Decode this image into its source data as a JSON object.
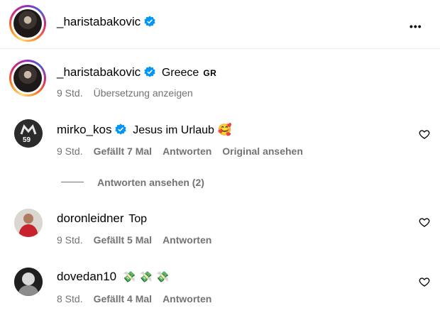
{
  "header": {
    "username": "_haristabakovic",
    "more_icon": "more-horizontal-icon",
    "more_glyph": "•••"
  },
  "caption": {
    "username": "_haristabakovic",
    "text": "Greece",
    "flag": "GR",
    "time": "9 Std.",
    "translate": "Übersetzung anzeigen"
  },
  "comments": [
    {
      "username": "mirko_kos",
      "verified": true,
      "text": "Jesus im Urlaub",
      "emoji": "🥰",
      "time": "9 Std.",
      "likes": "Gefällt 7 Mal",
      "reply": "Antworten",
      "original": "Original ansehen",
      "avatar_text": "59"
    },
    {
      "username": "doronleidner",
      "verified": false,
      "text": "Top",
      "time": "9 Std.",
      "likes": "Gefällt 5 Mal",
      "reply": "Antworten"
    },
    {
      "username": "dovedan10",
      "verified": false,
      "text": "💸 💸 💸",
      "time": "8 Std.",
      "likes": "Gefällt 4 Mal",
      "reply": "Antworten"
    }
  ],
  "replies_toggle": "Antworten ansehen (2)",
  "colors": {
    "verified_blue": "#0095f6",
    "muted": "#737373",
    "divider": "#efefef"
  }
}
